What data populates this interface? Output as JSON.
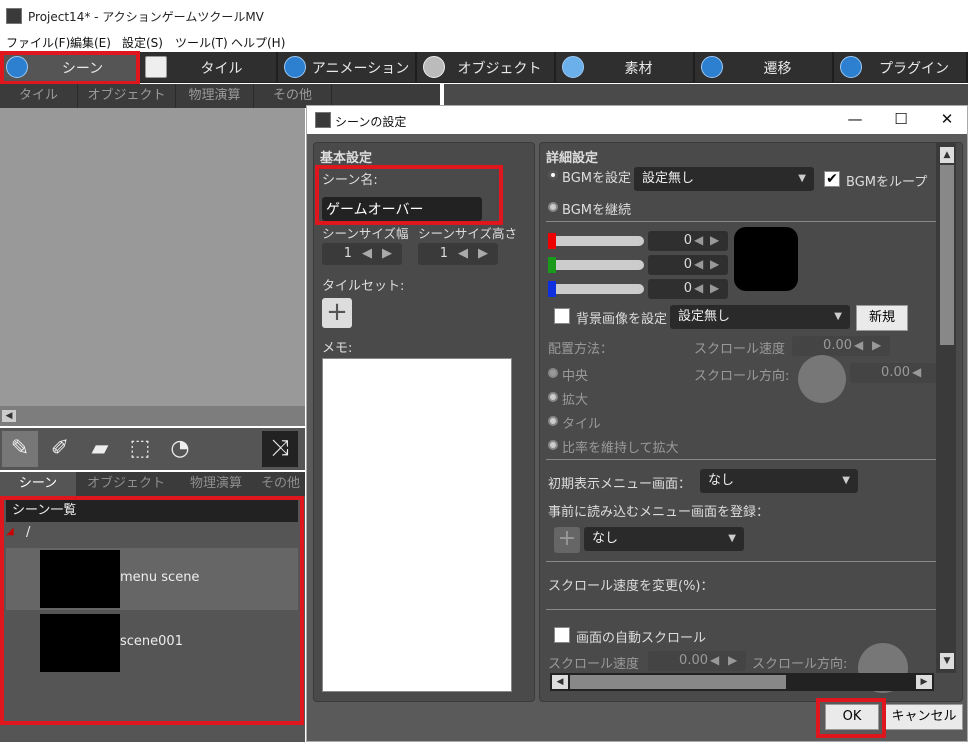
{
  "window": {
    "title": "Project14* - アクションゲームツクールMV"
  },
  "menubar": [
    "ファイル(F)",
    "編集(E)",
    "設定(S)",
    "ツール(T)",
    "ヘルプ(H)"
  ],
  "main_tabs": [
    {
      "label": "シーン",
      "icon": "scene-icon"
    },
    {
      "label": "タイル",
      "icon": "tile-icon"
    },
    {
      "label": "アニメーション",
      "icon": "animation-icon"
    },
    {
      "label": "オブジェクト",
      "icon": "object-icon"
    },
    {
      "label": "素材",
      "icon": "resource-icon"
    },
    {
      "label": "遷移",
      "icon": "transition-icon"
    },
    {
      "label": "プラグイン",
      "icon": "plugin-icon"
    }
  ],
  "sub_tabs": [
    "タイル",
    "オブジェクト",
    "物理演算",
    "その他"
  ],
  "bottom_tabs": [
    "シーン",
    "オブジェクト",
    "物理演算",
    "その他"
  ],
  "scene_list": {
    "header": "シーン一覧",
    "folder": "/",
    "items": [
      "menu scene",
      "scene001"
    ]
  },
  "dialog": {
    "title": "シーンの設定",
    "basic": {
      "heading": "基本設定",
      "scene_name_label": "シーン名:",
      "scene_name_value": "ゲームオーバー",
      "width_label": "シーンサイズ幅",
      "height_label": "シーンサイズ高さ",
      "width_value": "1",
      "height_value": "1",
      "tileset_label": "タイルセット:",
      "memo_label": "メモ:"
    },
    "detail": {
      "heading": "詳細設定",
      "bgm_set_label": "BGMを設定",
      "bgm_select": "設定無し",
      "bgm_loop_label": "BGMをループ",
      "bgm_loop_checked": true,
      "bgm_continue_label": "BGMを継続",
      "rgb": {
        "r": "0",
        "g": "0",
        "b": "0"
      },
      "bg_image_label": "背景画像を設定",
      "bg_image_select": "設定無し",
      "new_button": "新規",
      "placement_label": "配置方法：",
      "scroll_speed_label": "スクロール速度",
      "scroll_speed_value": "0.00",
      "scroll_dir_label": "スクロール方向:",
      "scroll_dir_value": "0.00",
      "placement_options": [
        "中央",
        "拡大",
        "タイル",
        "比率を維持して拡大"
      ],
      "initial_menu_label": "初期表示メニュー画面：",
      "initial_menu_value": "なし",
      "preload_menu_label": "事前に読み込むメニュー画面を登録：",
      "preload_menu_value": "なし",
      "scroll_speed_change_label": "スクロール速度を変更(%)：",
      "auto_scroll_label": "画面の自動スクロール",
      "auto_scroll_speed_label": "スクロール速度",
      "auto_scroll_speed_value": "0.00",
      "auto_scroll_dir_label": "スクロール方向:"
    },
    "ok_button": "OK",
    "cancel_button": "キャンセル"
  },
  "colors": {
    "highlight": "#e0161f",
    "accent_icon": "#2d7fd0"
  }
}
